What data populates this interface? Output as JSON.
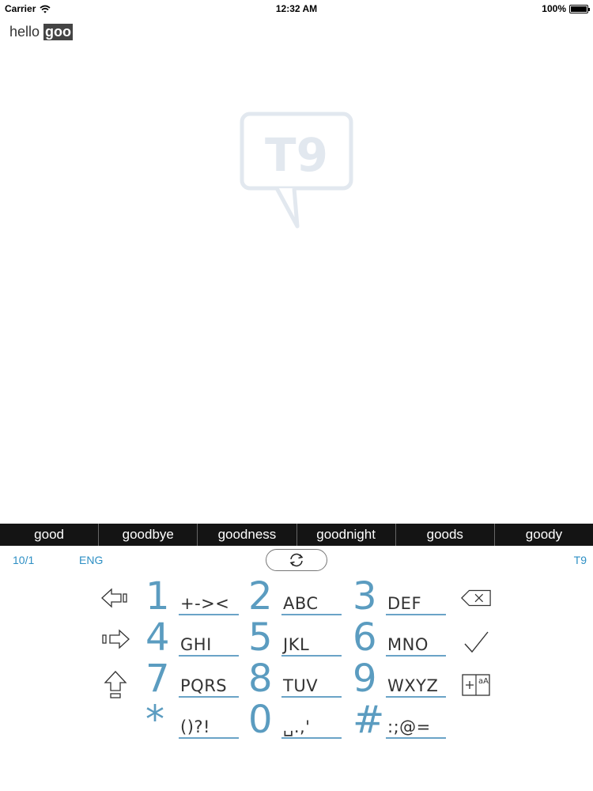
{
  "status_bar": {
    "carrier": "Carrier",
    "time": "12:32 AM",
    "battery": "100%"
  },
  "editor": {
    "typed_text": "hello",
    "composing_text": "goo"
  },
  "watermark": {
    "text": "T9"
  },
  "suggestions": [
    "good",
    "goodbye",
    "goodness",
    "goodnight",
    "goods",
    "goody"
  ],
  "keyboard": {
    "page_indicator": "10/1",
    "language": "ENG",
    "mode": "T9",
    "keys": [
      {
        "digit": "1",
        "letters": "+-><"
      },
      {
        "digit": "2",
        "letters": "ABC"
      },
      {
        "digit": "3",
        "letters": "DEF"
      },
      {
        "digit": "4",
        "letters": "GHI"
      },
      {
        "digit": "5",
        "letters": "JKL"
      },
      {
        "digit": "6",
        "letters": "MNO"
      },
      {
        "digit": "7",
        "letters": "PQRS"
      },
      {
        "digit": "8",
        "letters": "TUV"
      },
      {
        "digit": "9",
        "letters": "WXYZ"
      },
      {
        "digit": "*",
        "letters": "()?!"
      },
      {
        "digit": "0",
        "letters": "␣.,'"
      },
      {
        "digit": "#",
        "letters": ":;@="
      }
    ],
    "icons": {
      "cycle": "refresh-icon",
      "left": "arrow-left-icon",
      "right": "arrow-right-icon",
      "shift": "shift-icon",
      "backspace": "backspace-icon",
      "done": "checkmark-icon",
      "dictionary": "add-word-icon"
    },
    "colors": {
      "digit": "#5b9cc0",
      "accent": "#2d8fc4",
      "underline": "#6aa3c7"
    }
  }
}
